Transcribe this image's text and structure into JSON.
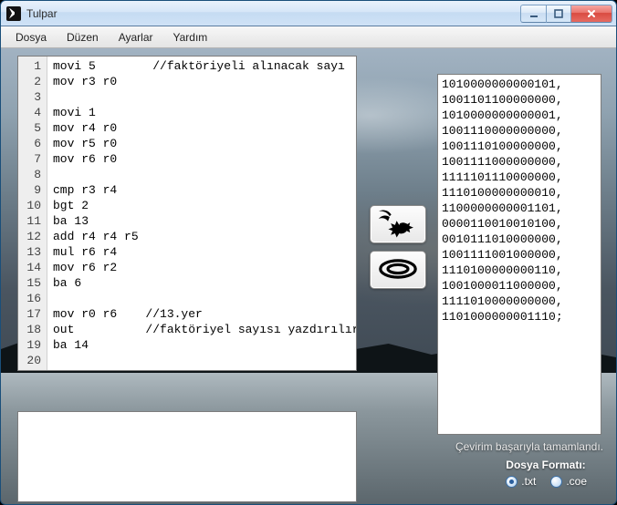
{
  "window": {
    "title": "Tulpar"
  },
  "menu": {
    "file": "Dosya",
    "edit": "Düzen",
    "settings": "Ayarlar",
    "help": "Yardım"
  },
  "editor": {
    "line_count": 20,
    "lines": [
      "movi 5        //faktöriyeli alınacak sayı",
      "mov r3 r0",
      "",
      "movi 1",
      "mov r4 r0",
      "mov r5 r0",
      "mov r6 r0",
      "",
      "cmp r3 r4",
      "bgt 2",
      "ba 13",
      "add r4 r4 r5",
      "mul r6 r4",
      "mov r6 r2",
      "ba 6",
      "",
      "mov r0 r6    //13.yer",
      "out          //faktöriyel sayısı yazdırılır",
      "ba 14",
      ""
    ]
  },
  "buttons": {
    "pegasus_name": "pegasus-icon",
    "swirl_name": "swirl-icon"
  },
  "output": {
    "lines": [
      "1010000000000101,",
      "1001101100000000,",
      "1010000000000001,",
      "1001110000000000,",
      "1001110100000000,",
      "1001111000000000,",
      "1111101110000000,",
      "1110100000000010,",
      "1100000000001101,",
      "0000110010010100,",
      "0010111010000000,",
      "1001111001000000,",
      "1110100000000110,",
      "1001000011000000,",
      "1111010000000000,",
      "1101000000001110;"
    ]
  },
  "status": {
    "message": "Çevirim başarıyla tamamlandı."
  },
  "format": {
    "label": "Dosya Formatı:",
    "opt_txt": ".txt",
    "opt_coe": ".coe",
    "selected": "txt"
  }
}
